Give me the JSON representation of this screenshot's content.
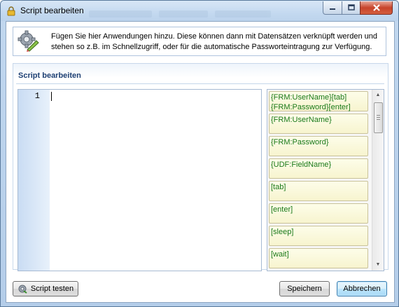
{
  "window": {
    "title": "Script bearbeiten"
  },
  "info": {
    "text": "Fügen Sie hier Anwendungen hinzu. Diese können dann mit Datensätzen verknüpft werden und stehen so z.B. im Schnellzugriff, oder für die automatische Passworteintragung zur Verfügung."
  },
  "editor": {
    "group_title": "Script bearbeiten",
    "line_number": "1",
    "content": ""
  },
  "snippets": [
    {
      "line1_green": "{FRM:UserName}",
      "line1_tag": "[tab]",
      "line2_green": "{FRM:Password}",
      "line2_tag": "[enter]"
    },
    {
      "line1_green": "{FRM:UserName}"
    },
    {
      "line1_green": "{FRM:Password}"
    },
    {
      "line1_green": "{UDF:FieldName}"
    },
    {
      "line1_green": "[tab]"
    },
    {
      "line1_green": "[enter]"
    },
    {
      "line1_green": "[sleep]"
    },
    {
      "line1_green": "[wait]"
    }
  ],
  "buttons": {
    "test": "Script testen",
    "save": "Speichern",
    "cancel": "Abbrechen"
  },
  "colors": {
    "snippet_text": "#1a7a1a",
    "group_title": "#1d3f73",
    "close_button": "#c7442b"
  }
}
